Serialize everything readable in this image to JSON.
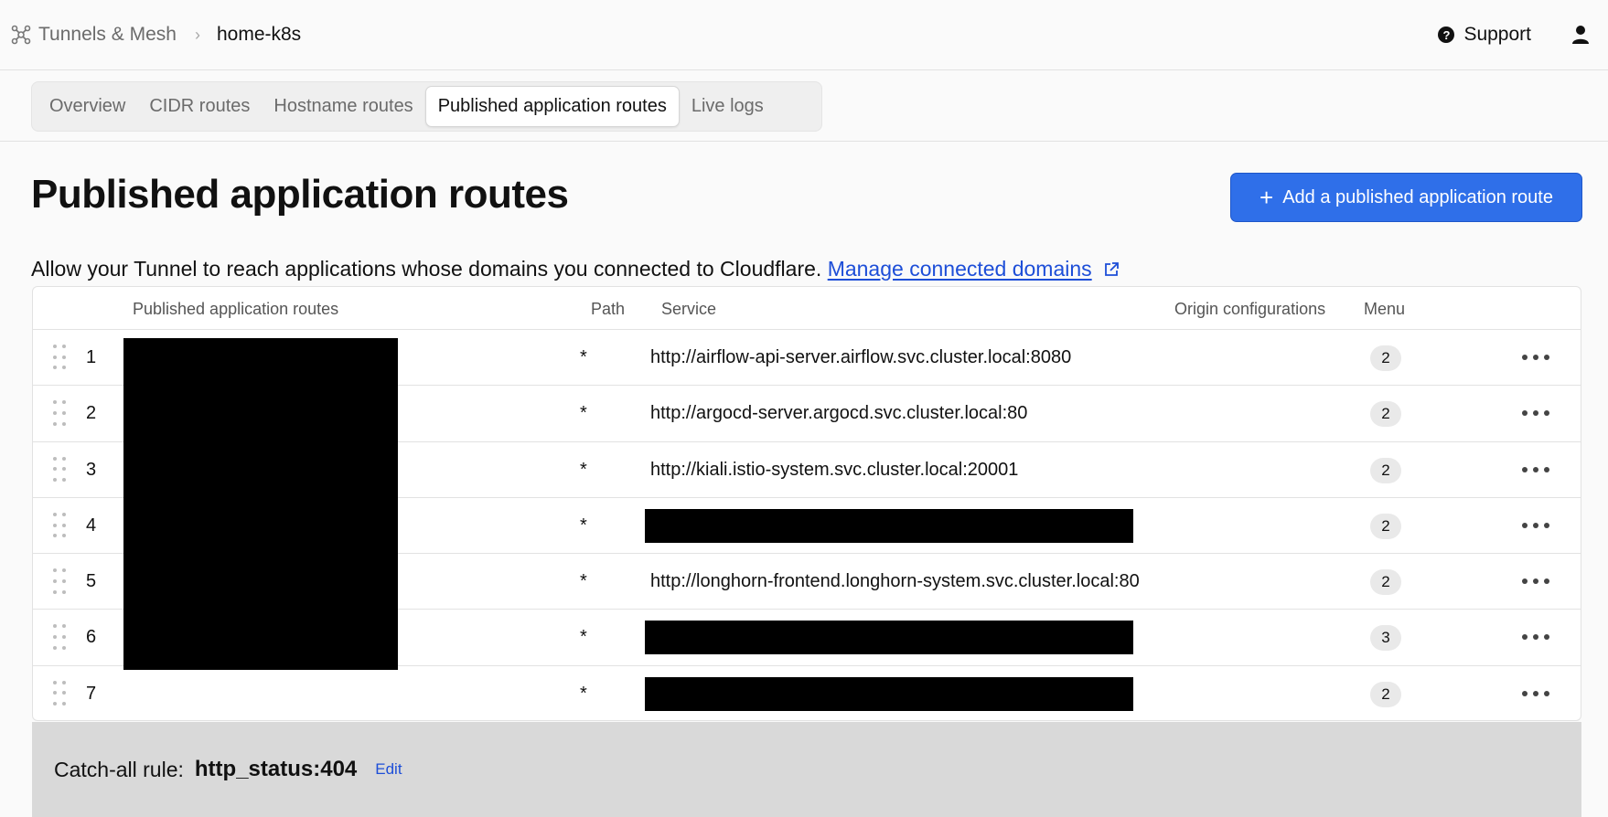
{
  "breadcrumb": {
    "parent": "Tunnels & Mesh",
    "current": "home-k8s"
  },
  "header": {
    "support_label": "Support"
  },
  "tabs": [
    {
      "label": "Overview",
      "active": false
    },
    {
      "label": "CIDR routes",
      "active": false
    },
    {
      "label": "Hostname routes",
      "active": false
    },
    {
      "label": "Published application routes",
      "active": true
    },
    {
      "label": "Live logs",
      "active": false
    }
  ],
  "page": {
    "title": "Published application routes",
    "add_button_label": "Add a published application route",
    "description": "Allow your Tunnel to reach applications whose domains you connected to Cloudflare.",
    "manage_link": "Manage connected domains"
  },
  "table": {
    "columns": [
      "Published application routes",
      "Path",
      "Service",
      "Origin configurations",
      "Menu"
    ],
    "rows": [
      {
        "index": "1",
        "path": "*",
        "service": "http://airflow-api-server.airflow.svc.cluster.local:8080",
        "service_redacted": false,
        "origin_configs": "2"
      },
      {
        "index": "2",
        "path": "*",
        "service": "http://argocd-server.argocd.svc.cluster.local:80",
        "service_redacted": false,
        "origin_configs": "2"
      },
      {
        "index": "3",
        "path": "*",
        "service": "http://kiali.istio-system.svc.cluster.local:20001",
        "service_redacted": false,
        "origin_configs": "2"
      },
      {
        "index": "4",
        "path": "*",
        "service": "",
        "service_redacted": true,
        "origin_configs": "2"
      },
      {
        "index": "5",
        "path": "*",
        "service": "http://longhorn-frontend.longhorn-system.svc.cluster.local:80",
        "service_redacted": false,
        "origin_configs": "2"
      },
      {
        "index": "6",
        "path": "*",
        "service": "",
        "service_redacted": true,
        "origin_configs": "3"
      },
      {
        "index": "7",
        "path": "*",
        "service": "",
        "service_redacted": true,
        "origin_configs": "2"
      }
    ]
  },
  "catch_all": {
    "label": "Catch-all rule:",
    "value": "http_status:404",
    "edit_label": "Edit"
  },
  "colors": {
    "accent": "#2f6fe9",
    "link": "#1d4ed8",
    "redaction": "#000000"
  },
  "icons": [
    "mesh-icon",
    "chevron-right-icon",
    "help-icon",
    "user-icon",
    "external-link-icon",
    "plus-icon",
    "drag-handle-icon",
    "more-horizontal-icon"
  ]
}
